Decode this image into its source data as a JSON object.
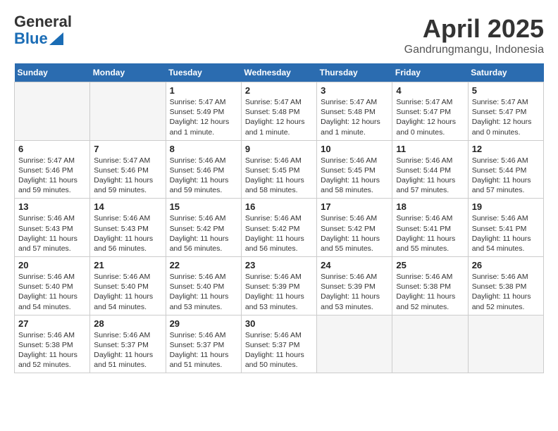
{
  "header": {
    "logo_general": "General",
    "logo_blue": "Blue",
    "month": "April 2025",
    "location": "Gandrungmangu, Indonesia"
  },
  "weekdays": [
    "Sunday",
    "Monday",
    "Tuesday",
    "Wednesday",
    "Thursday",
    "Friday",
    "Saturday"
  ],
  "weeks": [
    [
      {
        "day": "",
        "empty": true
      },
      {
        "day": "",
        "empty": true
      },
      {
        "day": "1",
        "sunrise": "5:47 AM",
        "sunset": "5:49 PM",
        "daylight": "12 hours and 1 minute."
      },
      {
        "day": "2",
        "sunrise": "5:47 AM",
        "sunset": "5:48 PM",
        "daylight": "12 hours and 1 minute."
      },
      {
        "day": "3",
        "sunrise": "5:47 AM",
        "sunset": "5:48 PM",
        "daylight": "12 hours and 1 minute."
      },
      {
        "day": "4",
        "sunrise": "5:47 AM",
        "sunset": "5:47 PM",
        "daylight": "12 hours and 0 minutes."
      },
      {
        "day": "5",
        "sunrise": "5:47 AM",
        "sunset": "5:47 PM",
        "daylight": "12 hours and 0 minutes."
      }
    ],
    [
      {
        "day": "6",
        "sunrise": "5:47 AM",
        "sunset": "5:46 PM",
        "daylight": "11 hours and 59 minutes."
      },
      {
        "day": "7",
        "sunrise": "5:47 AM",
        "sunset": "5:46 PM",
        "daylight": "11 hours and 59 minutes."
      },
      {
        "day": "8",
        "sunrise": "5:46 AM",
        "sunset": "5:46 PM",
        "daylight": "11 hours and 59 minutes."
      },
      {
        "day": "9",
        "sunrise": "5:46 AM",
        "sunset": "5:45 PM",
        "daylight": "11 hours and 58 minutes."
      },
      {
        "day": "10",
        "sunrise": "5:46 AM",
        "sunset": "5:45 PM",
        "daylight": "11 hours and 58 minutes."
      },
      {
        "day": "11",
        "sunrise": "5:46 AM",
        "sunset": "5:44 PM",
        "daylight": "11 hours and 57 minutes."
      },
      {
        "day": "12",
        "sunrise": "5:46 AM",
        "sunset": "5:44 PM",
        "daylight": "11 hours and 57 minutes."
      }
    ],
    [
      {
        "day": "13",
        "sunrise": "5:46 AM",
        "sunset": "5:43 PM",
        "daylight": "11 hours and 57 minutes."
      },
      {
        "day": "14",
        "sunrise": "5:46 AM",
        "sunset": "5:43 PM",
        "daylight": "11 hours and 56 minutes."
      },
      {
        "day": "15",
        "sunrise": "5:46 AM",
        "sunset": "5:42 PM",
        "daylight": "11 hours and 56 minutes."
      },
      {
        "day": "16",
        "sunrise": "5:46 AM",
        "sunset": "5:42 PM",
        "daylight": "11 hours and 56 minutes."
      },
      {
        "day": "17",
        "sunrise": "5:46 AM",
        "sunset": "5:42 PM",
        "daylight": "11 hours and 55 minutes."
      },
      {
        "day": "18",
        "sunrise": "5:46 AM",
        "sunset": "5:41 PM",
        "daylight": "11 hours and 55 minutes."
      },
      {
        "day": "19",
        "sunrise": "5:46 AM",
        "sunset": "5:41 PM",
        "daylight": "11 hours and 54 minutes."
      }
    ],
    [
      {
        "day": "20",
        "sunrise": "5:46 AM",
        "sunset": "5:40 PM",
        "daylight": "11 hours and 54 minutes."
      },
      {
        "day": "21",
        "sunrise": "5:46 AM",
        "sunset": "5:40 PM",
        "daylight": "11 hours and 54 minutes."
      },
      {
        "day": "22",
        "sunrise": "5:46 AM",
        "sunset": "5:40 PM",
        "daylight": "11 hours and 53 minutes."
      },
      {
        "day": "23",
        "sunrise": "5:46 AM",
        "sunset": "5:39 PM",
        "daylight": "11 hours and 53 minutes."
      },
      {
        "day": "24",
        "sunrise": "5:46 AM",
        "sunset": "5:39 PM",
        "daylight": "11 hours and 53 minutes."
      },
      {
        "day": "25",
        "sunrise": "5:46 AM",
        "sunset": "5:38 PM",
        "daylight": "11 hours and 52 minutes."
      },
      {
        "day": "26",
        "sunrise": "5:46 AM",
        "sunset": "5:38 PM",
        "daylight": "11 hours and 52 minutes."
      }
    ],
    [
      {
        "day": "27",
        "sunrise": "5:46 AM",
        "sunset": "5:38 PM",
        "daylight": "11 hours and 52 minutes."
      },
      {
        "day": "28",
        "sunrise": "5:46 AM",
        "sunset": "5:37 PM",
        "daylight": "11 hours and 51 minutes."
      },
      {
        "day": "29",
        "sunrise": "5:46 AM",
        "sunset": "5:37 PM",
        "daylight": "11 hours and 51 minutes."
      },
      {
        "day": "30",
        "sunrise": "5:46 AM",
        "sunset": "5:37 PM",
        "daylight": "11 hours and 50 minutes."
      },
      {
        "day": "",
        "empty": true
      },
      {
        "day": "",
        "empty": true
      },
      {
        "day": "",
        "empty": true
      }
    ]
  ],
  "labels": {
    "sunrise": "Sunrise:",
    "sunset": "Sunset:",
    "daylight": "Daylight:"
  }
}
